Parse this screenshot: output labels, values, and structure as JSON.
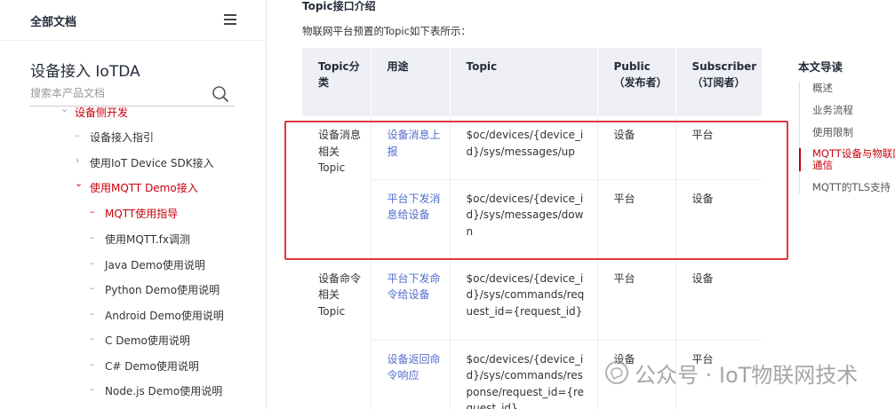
{
  "sidebar": {
    "all_docs": "全部文档",
    "product": "设备接入 IoTDA",
    "search_placeholder": "搜索本产品文档",
    "items": [
      {
        "label": "设备侧开发",
        "mark": "⌄"
      },
      {
        "label": "设备接入指引",
        "mark": "–"
      },
      {
        "label": "使用IoT Device SDK接入",
        "mark": "›"
      },
      {
        "label": "使用MQTT Demo接入",
        "mark": "⌄"
      },
      {
        "label": "MQTT使用指导",
        "mark": "–"
      },
      {
        "label": "使用MQTT.fx调测",
        "mark": "–"
      },
      {
        "label": "Java Demo使用说明",
        "mark": "–"
      },
      {
        "label": "Python Demo使用说明",
        "mark": "–"
      },
      {
        "label": "Android Demo使用说明",
        "mark": "–"
      },
      {
        "label": "C Demo使用说明",
        "mark": "–"
      },
      {
        "label": "C# Demo使用说明",
        "mark": "–"
      },
      {
        "label": "Node.js Demo使用说明",
        "mark": "–"
      }
    ]
  },
  "main": {
    "section_title": "Topic接口介绍",
    "intro": "物联网平台预置的Topic如下表所示：",
    "table": {
      "headers": [
        "Topic分类",
        "用途",
        "Topic",
        "Public（发布者）",
        "Subscriber（订阅者）"
      ],
      "groups": [
        {
          "category": "设备消息相关Topic",
          "rows": [
            {
              "use": "设备消息上报",
              "topic": "$oc/devices/{device_id}/sys/messages/up",
              "public": "设备",
              "subscriber": "平台"
            },
            {
              "use": "平台下发消息给设备",
              "topic": "$oc/devices/{device_id}/sys/messages/down",
              "public": "平台",
              "subscriber": "设备"
            }
          ]
        },
        {
          "category": "设备命令相关Topic",
          "rows": [
            {
              "use": "平台下发命令给设备",
              "topic": "$oc/devices/{device_id}/sys/commands/request_id={request_id}",
              "public": "平台",
              "subscriber": "设备"
            },
            {
              "use": "设备返回命令响应",
              "topic": "$oc/devices/{device_id}/sys/commands/response/request_id={request_id}",
              "public": "设备",
              "subscriber": "平台"
            }
          ]
        }
      ]
    }
  },
  "toc": {
    "title": "本文导读",
    "items": [
      "概述",
      "业务流程",
      "使用限制",
      "MQTT设备与物联网平台通信",
      "MQTT的TLS支持"
    ]
  },
  "watermark": {
    "text": "公众号 · IoT物联网技术"
  },
  "colors": {
    "accent_red": "#c7000b",
    "link_blue": "#526ecc",
    "highlight_box": "#e0373d",
    "table_header_bg": "#eef0f5"
  },
  "icons": {
    "menu": "hamburger-icon",
    "search": "search-icon",
    "watermark": "wechat-official-account-icon"
  }
}
